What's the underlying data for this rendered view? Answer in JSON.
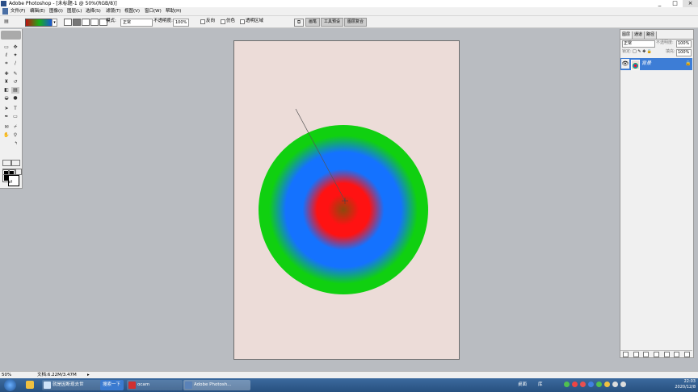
{
  "window": {
    "title": "Adobe Photoshop - [未标题-1 @ 50%(RGB/8)]",
    "controls": {
      "min": "_",
      "max": "□",
      "close": "×"
    }
  },
  "menu": [
    "文件(F)",
    "编辑(E)",
    "图像(I)",
    "图层(L)",
    "选择(S)",
    "滤镜(T)",
    "视图(V)",
    "窗口(W)",
    "帮助(H)"
  ],
  "options": {
    "mode_label": "模式:",
    "mode_value": "正常",
    "opacity_label": "不透明度:",
    "opacity_value": "100%",
    "reverse_label": "反向",
    "dither_label": "仿色",
    "transparency_label": "透明区域",
    "tabs": [
      "画笔",
      "工具预设",
      "图层复合"
    ],
    "gradient_colors": [
      "#c01010",
      "#18b018",
      "#1a50e0"
    ]
  },
  "tools": {
    "icons": [
      "marquee-icon",
      "move-icon",
      "lasso-icon",
      "magic-wand-icon",
      "crop-icon",
      "slice-icon",
      "healing-icon",
      "brush-icon",
      "stamp-icon",
      "history-brush-icon",
      "eraser-icon",
      "gradient-icon",
      "blur-icon",
      "dodge-icon",
      "path-select-icon",
      "type-icon",
      "pen-icon",
      "shape-icon",
      "notes-icon",
      "eyedropper-icon",
      "hand-icon",
      "zoom-icon"
    ],
    "foreground_color": "#000000",
    "background_color": "#ffffff"
  },
  "canvas": {
    "background_color": "#ecdcd8",
    "gradient": {
      "type": "radial",
      "stops": [
        "#8a4a0e",
        "#ff1212",
        "#1472ff",
        "#10d010"
      ]
    }
  },
  "layers_panel": {
    "tabs": [
      "图层",
      "通道",
      "路径"
    ],
    "blend_mode": "正常",
    "opacity_label": "不透明度:",
    "opacity_value": "100%",
    "lock_label": "锁定:",
    "fill_label": "填充:",
    "fill_value": "100%",
    "layers": [
      {
        "name": "背景",
        "visible": true,
        "locked": true
      }
    ]
  },
  "status": {
    "zoom": "50%",
    "doc": "文档:6.22M/3.47M"
  },
  "taskbar": {
    "items": [
      "就是因断现去世",
      "搜索一下",
      "ocam",
      "Adobe Photosh..."
    ],
    "tray_left": [
      "桌面",
      "库"
    ],
    "time": "22:03",
    "date": "2020/12/8"
  }
}
